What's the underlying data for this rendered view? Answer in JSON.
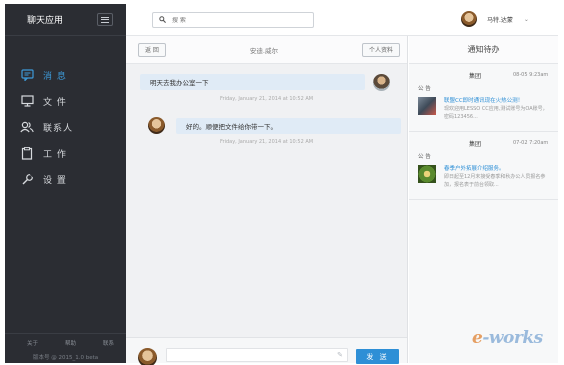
{
  "app": {
    "title": "聊天应用"
  },
  "sidebar": {
    "items": [
      {
        "label": "消 息",
        "icon": "chat-icon",
        "active": true
      },
      {
        "label": "文 件",
        "icon": "monitor-icon",
        "active": false
      },
      {
        "label": "联系人",
        "icon": "contacts-icon",
        "active": false
      },
      {
        "label": "工 作",
        "icon": "clipboard-icon",
        "active": false
      },
      {
        "label": "设 置",
        "icon": "settings-icon",
        "active": false
      }
    ],
    "footer_links": [
      "关于",
      "帮助",
      "联系"
    ],
    "version": "版本号 @ 2015_1.0 beta"
  },
  "header": {
    "search_placeholder": "搜 索",
    "user_name": "马特.达蒙"
  },
  "chat": {
    "back_label": "返 回",
    "contact_name": "安迪.威尔",
    "profile_label": "个人资料",
    "messages": [
      {
        "text": "明天去我办公室一下",
        "time": "Friday, January 21, 2014 at 10:52 AM",
        "side": "right"
      },
      {
        "text": "好的。顺便把文件给你带一下。",
        "time": "Friday, January 21, 2014 at 10:52 AM",
        "side": "left"
      }
    ],
    "send_label": "发 送"
  },
  "notices": {
    "title": "通知待办",
    "items": [
      {
        "group": "集团",
        "time": "08-05 9:23am",
        "type": "公 告",
        "headline": "联盟CC即时通讯现在火热公测！",
        "desc": "现欢迎用LESSO CC应用,测试账号为OA账号，密码123456..."
      },
      {
        "group": "集团",
        "time": "07-02 7:20am",
        "type": "公 告",
        "headline": "春季户外拓展介绍服务。",
        "desc": "即日起至12月末接受春季和秋办公人员报名参加，报名表于前台领取..."
      }
    ]
  },
  "watermark": {
    "text_e": "e",
    "text_rest": "-works"
  },
  "colors": {
    "accent": "#2e8fd6",
    "sidebar_bg": "#2b2d33",
    "bubble_bg": "#e0ebf6"
  }
}
